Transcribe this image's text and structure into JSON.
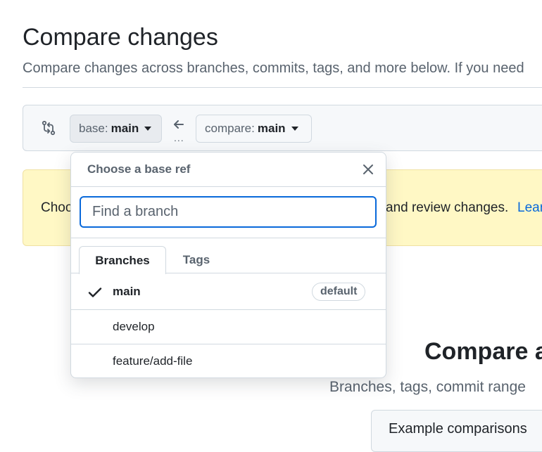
{
  "header": {
    "title": "Compare changes",
    "subtitle": "Compare changes across branches, commits, tags, and more below. If you need"
  },
  "range": {
    "base_label": "base:",
    "base_value": "main",
    "compare_label": "compare:",
    "compare_value": "main",
    "dots": "..."
  },
  "flash": {
    "text_start": "Choo",
    "text_end": "and review changes.",
    "link": "Lear"
  },
  "blank_state": {
    "title": "Compare a",
    "subtitle": "Branches, tags, commit range",
    "examples_label": "Example comparisons"
  },
  "dropdown": {
    "title": "Choose a base ref",
    "search_placeholder": "Find a branch",
    "tabs": [
      {
        "label": "Branches",
        "selected": true
      },
      {
        "label": "Tags",
        "selected": false
      }
    ],
    "branches": [
      {
        "name": "main",
        "selected": true,
        "badge": "default"
      },
      {
        "name": "develop",
        "selected": false
      },
      {
        "name": "feature/add-file",
        "selected": false
      }
    ]
  },
  "icons": {
    "compare": "git-compare-icon",
    "arrow": "arrow-left-icon",
    "close": "close-icon",
    "check": "check-icon"
  },
  "colors": {
    "accent": "#0969da",
    "flash_bg": "#fff8c5",
    "muted": "#59636e"
  }
}
